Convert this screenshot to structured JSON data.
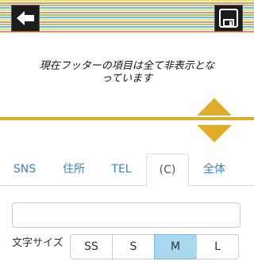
{
  "header": {
    "back_icon": "back-arrow-icon",
    "save_icon": "floppy-save-icon"
  },
  "message": {
    "line1": "現在フッターの項目は全て非表示とな",
    "line2": "っています"
  },
  "reorder": {
    "up_icon": "triangle-up-icon",
    "down_icon": "triangle-down-icon",
    "color": "#e0ad2a"
  },
  "tabs": [
    {
      "label": "SNS"
    },
    {
      "label": "住所"
    },
    {
      "label": "TEL"
    },
    {
      "label": "(C)"
    },
    {
      "label": "全体"
    }
  ],
  "active_tab": "(C)",
  "input": {
    "value": ""
  },
  "font_size": {
    "label": "文字サイズ",
    "options": [
      "SS",
      "S",
      "M",
      "L"
    ],
    "selected": "M"
  }
}
